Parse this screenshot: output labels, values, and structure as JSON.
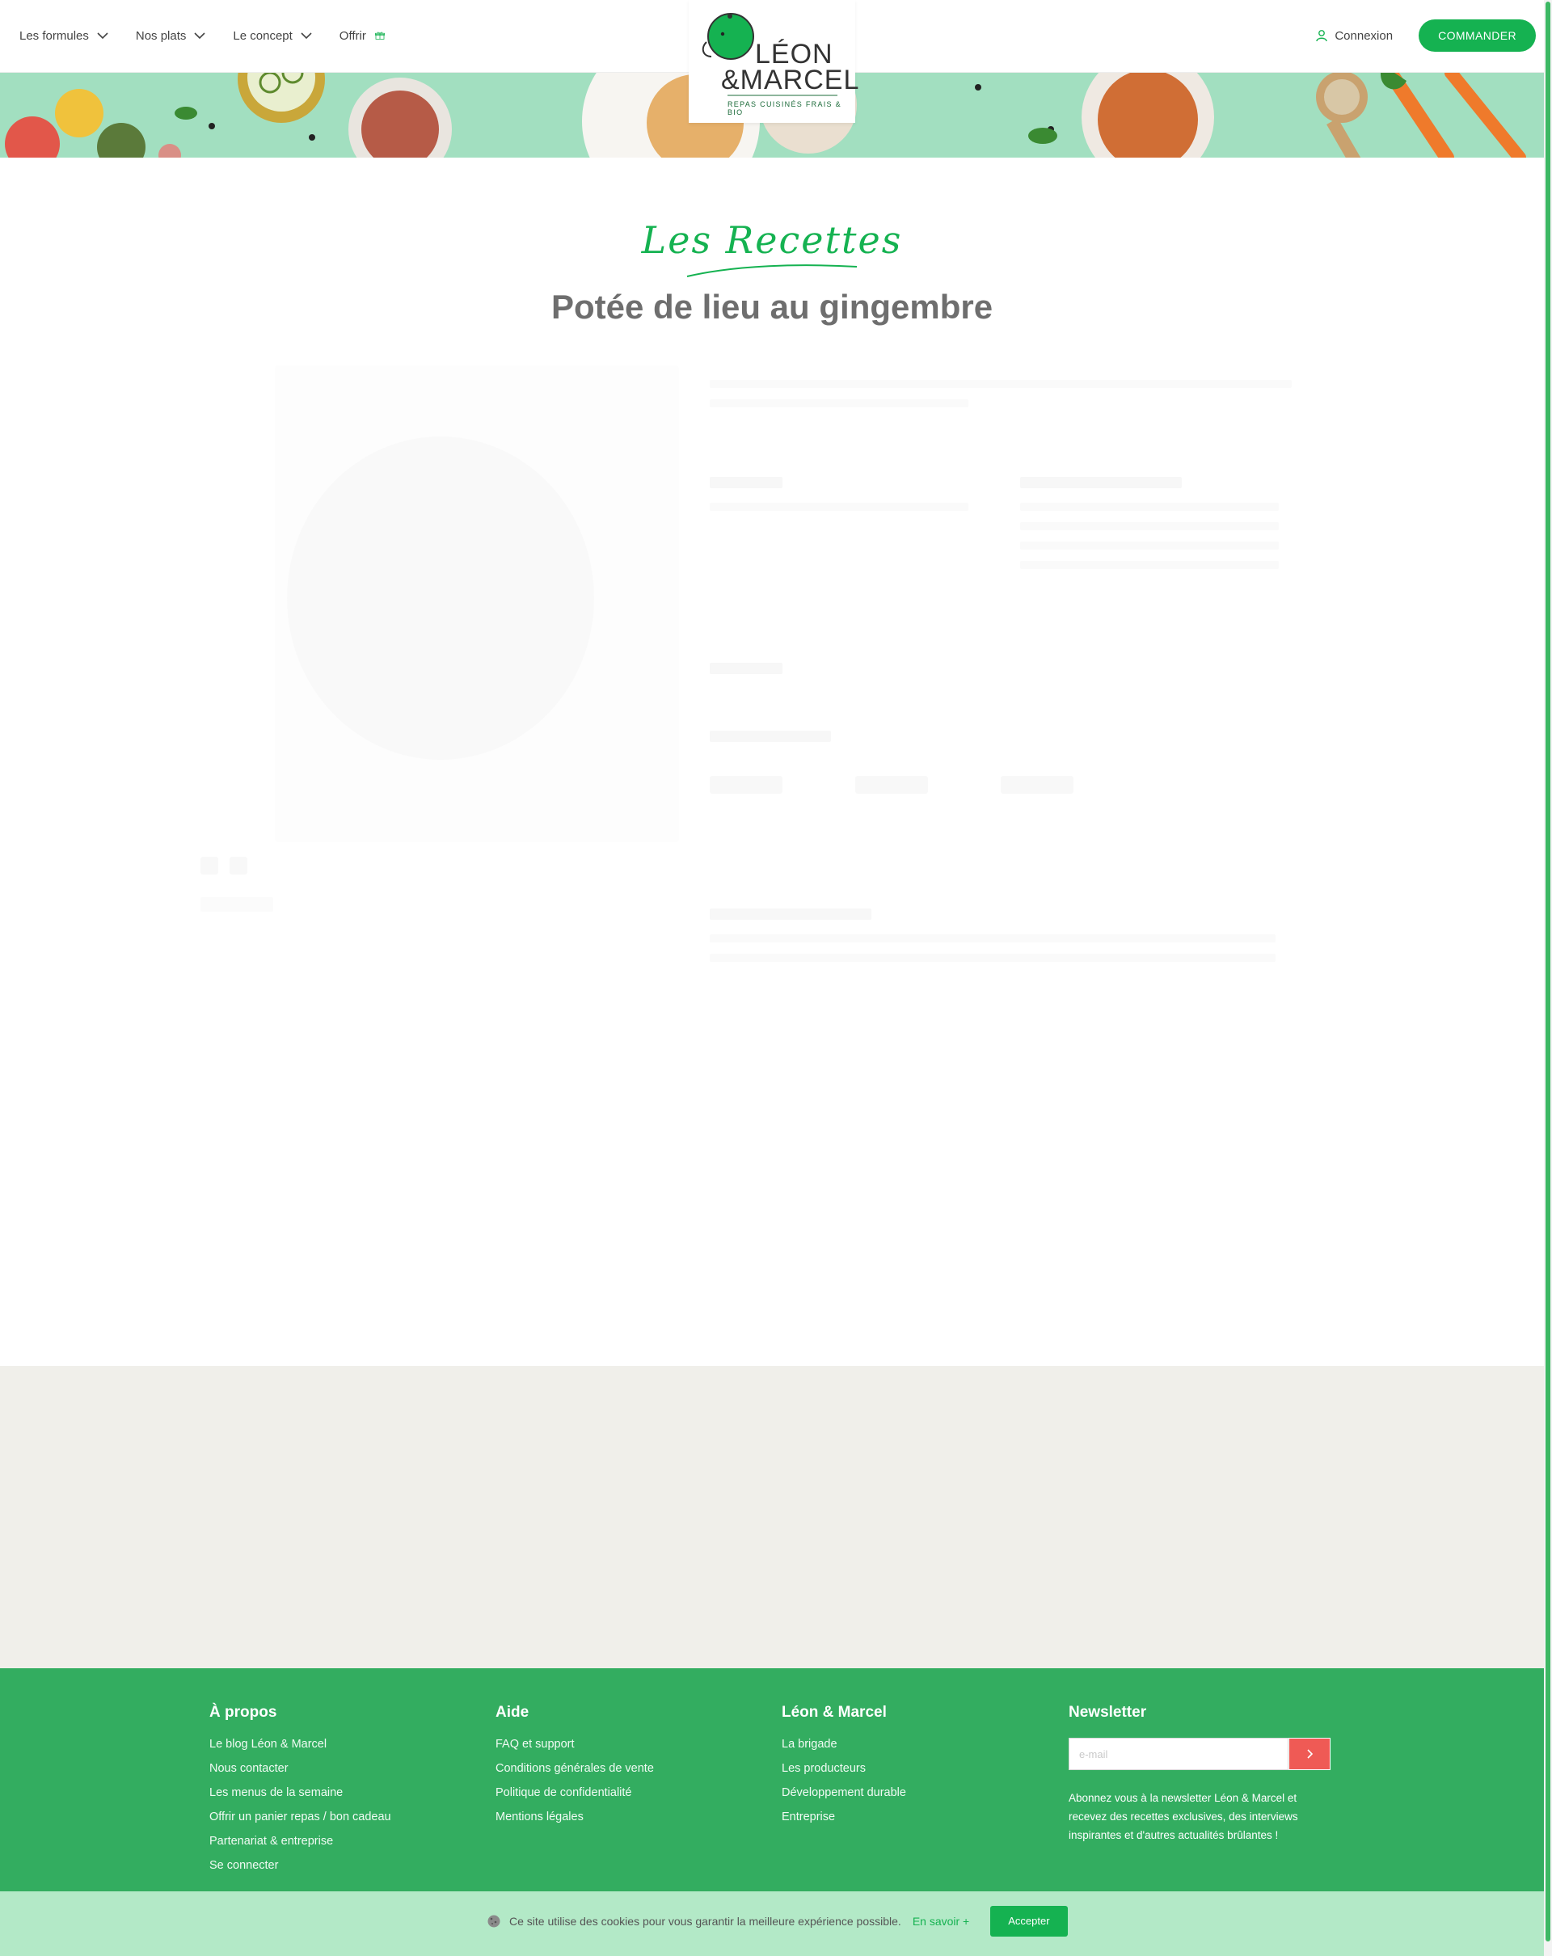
{
  "header": {
    "nav": [
      {
        "label": "Les formules",
        "icon": "chevron-down-icon"
      },
      {
        "label": "Nos plats",
        "icon": "chevron-down-icon"
      },
      {
        "label": "Le concept",
        "icon": "chevron-down-icon"
      },
      {
        "label": "Offrir",
        "icon": "gift-icon"
      }
    ],
    "logo": {
      "line1": "LÉON",
      "line2": "&MARCEL",
      "tagline": "REPAS CUISINÉS FRAIS & BIO"
    },
    "login_label": "Connexion",
    "order_label": "COMMANDER"
  },
  "recipe": {
    "section_label": "Les Recettes",
    "title": "Potée de lieu au gingembre"
  },
  "footer": {
    "about": {
      "title": "À propos",
      "links": [
        "Le blog Léon & Marcel",
        "Nous contacter",
        "Les menus de la semaine",
        "Offrir un panier repas / bon cadeau",
        "Partenariat & entreprise",
        "Se connecter"
      ]
    },
    "help": {
      "title": "Aide",
      "links": [
        "FAQ et support",
        "Conditions générales de vente",
        "Politique de confidentialité",
        "Mentions légales"
      ]
    },
    "brand": {
      "title": "Léon & Marcel",
      "links": [
        "La brigade",
        "Les producteurs",
        "Développement durable",
        "Entreprise"
      ]
    },
    "newsletter": {
      "title": "Newsletter",
      "placeholder": "e-mail",
      "description": "Abonnez vous à la newsletter Léon & Marcel et recevez des recettes exclusives, des interviews inspirantes et d'autres actualités brûlantes !"
    }
  },
  "cookie": {
    "text": "Ce site utilise des cookies pour vous garantir la meilleure expérience possible.",
    "link": "En savoir +",
    "accept": "Accepter"
  },
  "colors": {
    "brand_green": "#15b251",
    "footer_green": "#33ad60",
    "banner_mint": "#a2dfc0",
    "newsletter_red": "#ef5a55"
  }
}
